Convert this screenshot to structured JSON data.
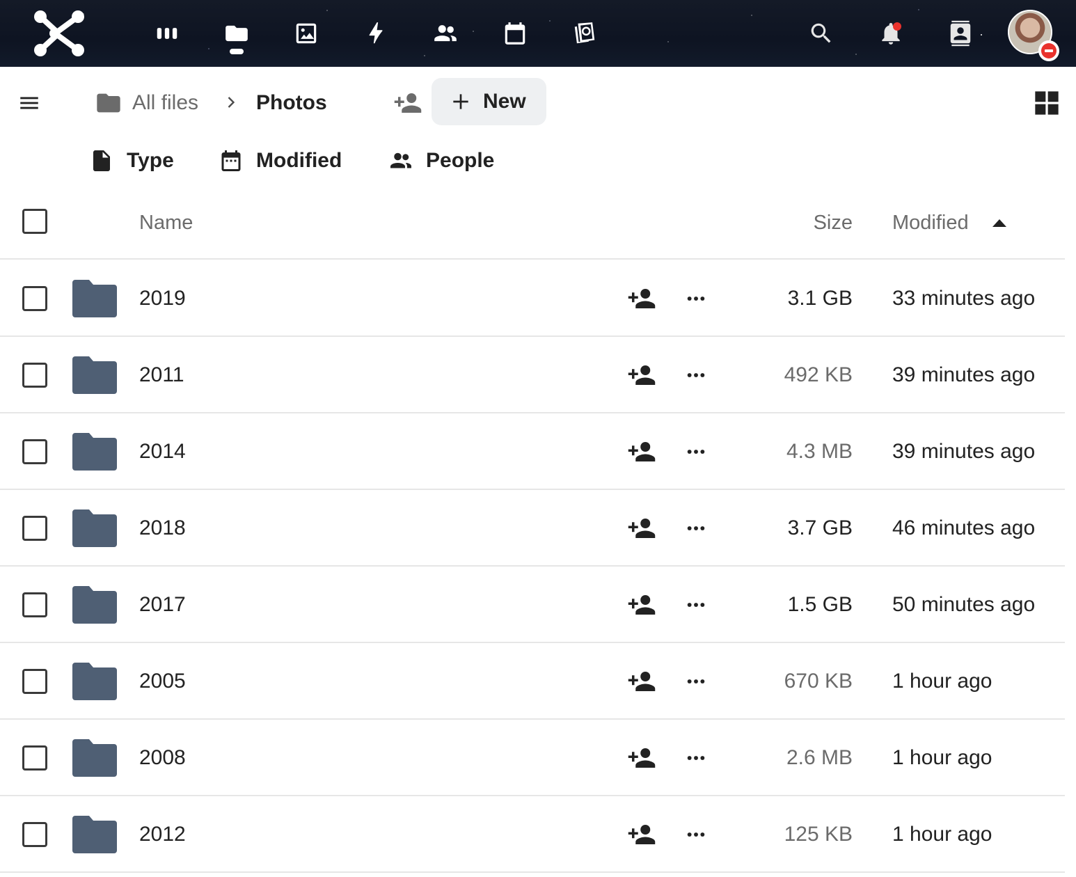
{
  "topbar": {
    "apps": [
      {
        "name": "dashboard-icon"
      },
      {
        "name": "files-icon",
        "active": true
      },
      {
        "name": "photos-icon"
      },
      {
        "name": "activity-icon"
      },
      {
        "name": "contacts-icon"
      },
      {
        "name": "calendar-icon"
      },
      {
        "name": "memories-icon"
      }
    ],
    "right": [
      "search-icon",
      "notifications-icon",
      "contacts-menu-icon",
      "avatar"
    ]
  },
  "breadcrumb": {
    "root": "All files",
    "current": "Photos"
  },
  "toolbar": {
    "new_label": "New"
  },
  "filters": {
    "type": "Type",
    "modified": "Modified",
    "people": "People"
  },
  "table": {
    "headers": {
      "name": "Name",
      "size": "Size",
      "modified": "Modified"
    },
    "sort": {
      "column": "modified",
      "direction": "ascending"
    },
    "rows": [
      {
        "name": "2019",
        "size": "3.1 GB",
        "modified": "33 minutes ago",
        "size_emphasis": true
      },
      {
        "name": "2011",
        "size": "492 KB",
        "modified": "39 minutes ago",
        "size_emphasis": false
      },
      {
        "name": "2014",
        "size": "4.3 MB",
        "modified": "39 minutes ago",
        "size_emphasis": false
      },
      {
        "name": "2018",
        "size": "3.7 GB",
        "modified": "46 minutes ago",
        "size_emphasis": true
      },
      {
        "name": "2017",
        "size": "1.5 GB",
        "modified": "50 minutes ago",
        "size_emphasis": true
      },
      {
        "name": "2005",
        "size": "670 KB",
        "modified": "1 hour ago",
        "size_emphasis": false
      },
      {
        "name": "2008",
        "size": "2.6 MB",
        "modified": "1 hour ago",
        "size_emphasis": false
      },
      {
        "name": "2012",
        "size": "125 KB",
        "modified": "1 hour ago",
        "size_emphasis": false
      }
    ]
  },
  "colors": {
    "folder": "#4f5f74",
    "size_strong": "#222222",
    "size_muted": "#6b6b6b",
    "notification": "#e9322d",
    "chip_bg": "#eef0f2"
  }
}
